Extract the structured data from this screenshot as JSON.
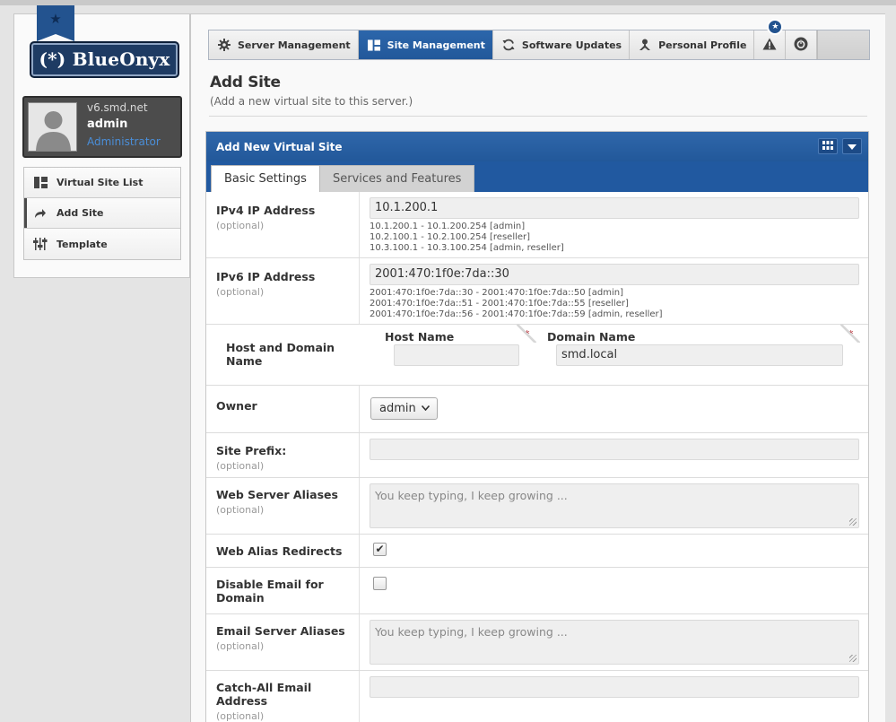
{
  "sidebar": {
    "logo_text": "(*) BlueOnyx",
    "user": {
      "host": "v6.smd.net",
      "name": "admin",
      "role": "Administrator"
    },
    "nav": [
      {
        "label": "Virtual Site List",
        "icon": "layout-icon"
      },
      {
        "label": "Add Site",
        "icon": "share-arrow-icon"
      },
      {
        "label": "Template",
        "icon": "sliders-icon"
      }
    ]
  },
  "topnav": {
    "items": [
      {
        "label": "Server Management",
        "icon": "gear-icon"
      },
      {
        "label": "Site Management",
        "icon": "layout-icon"
      },
      {
        "label": "Software Updates",
        "icon": "refresh-icon"
      },
      {
        "label": "Personal Profile",
        "icon": "person-icon"
      }
    ],
    "badge": "★"
  },
  "page": {
    "title": "Add Site",
    "subtitle": "(Add a new virtual site to this server.)"
  },
  "form": {
    "header": "Add New Virtual Site",
    "tabs": [
      "Basic Settings",
      "Services and Features"
    ],
    "optional": "(optional)",
    "ipv4": {
      "label": "IPv4 IP Address",
      "value": "10.1.200.1",
      "hints": [
        "10.1.200.1 - 10.1.200.254 [admin]",
        "10.2.100.1 - 10.2.100.254 [reseller]",
        "10.3.100.1 - 10.3.100.254 [admin, reseller]"
      ]
    },
    "ipv6": {
      "label": "IPv6 IP Address",
      "value": "2001:470:1f0e:7da::30",
      "hints": [
        "2001:470:1f0e:7da::30 - 2001:470:1f0e:7da::50 [admin]",
        "2001:470:1f0e:7da::51 - 2001:470:1f0e:7da::55 [reseller]",
        "2001:470:1f0e:7da::56 - 2001:470:1f0e:7da::59 [admin, reseller]"
      ]
    },
    "host_domain": {
      "label": "Host and Domain Name",
      "host_label": "Host Name",
      "host_value": "",
      "domain_label": "Domain Name",
      "domain_value": "smd.local",
      "required_mark": "*"
    },
    "owner": {
      "label": "Owner",
      "value": "admin"
    },
    "site_prefix": {
      "label": "Site Prefix:",
      "value": ""
    },
    "web_aliases": {
      "label": "Web Server Aliases",
      "placeholder": "You keep typing, I keep growing ..."
    },
    "web_alias_redirects": {
      "label": "Web Alias Redirects",
      "checked": true,
      "mark": "✔"
    },
    "disable_email": {
      "label": "Disable Email for Domain",
      "checked": false
    },
    "email_aliases": {
      "label": "Email Server Aliases",
      "placeholder": "You keep typing, I keep growing ..."
    },
    "catch_all": {
      "label": "Catch-All Email Address",
      "value": ""
    }
  }
}
